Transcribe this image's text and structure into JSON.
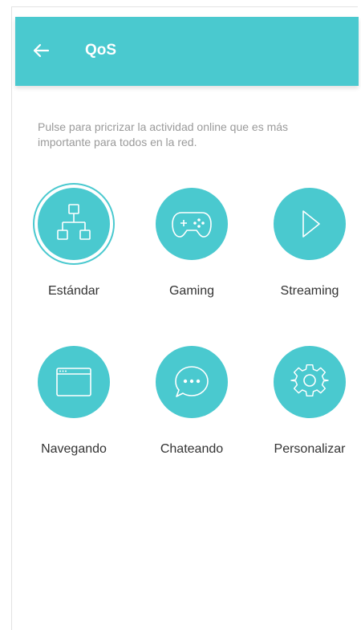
{
  "colors": {
    "accent": "#4ac9cf",
    "appbar_text": "#ffffff",
    "description_text": "#9a9a9a",
    "label_text": "#333333"
  },
  "appbar": {
    "title": "QoS",
    "back_icon": "arrow-left-icon"
  },
  "description": "Pulse para pricrizar la actividad online que es más importante para todos en la red.",
  "modes": [
    {
      "label": "Estándar",
      "icon": "network-hierarchy-icon",
      "selected": true
    },
    {
      "label": "Gaming",
      "icon": "gamepad-icon",
      "selected": false
    },
    {
      "label": "Streaming",
      "icon": "play-icon",
      "selected": false
    },
    {
      "label": "Navegando",
      "icon": "browser-window-icon",
      "selected": false
    },
    {
      "label": "Chateando",
      "icon": "chat-bubble-icon",
      "selected": false
    },
    {
      "label": "Personalizar",
      "icon": "gear-icon",
      "selected": false
    }
  ]
}
